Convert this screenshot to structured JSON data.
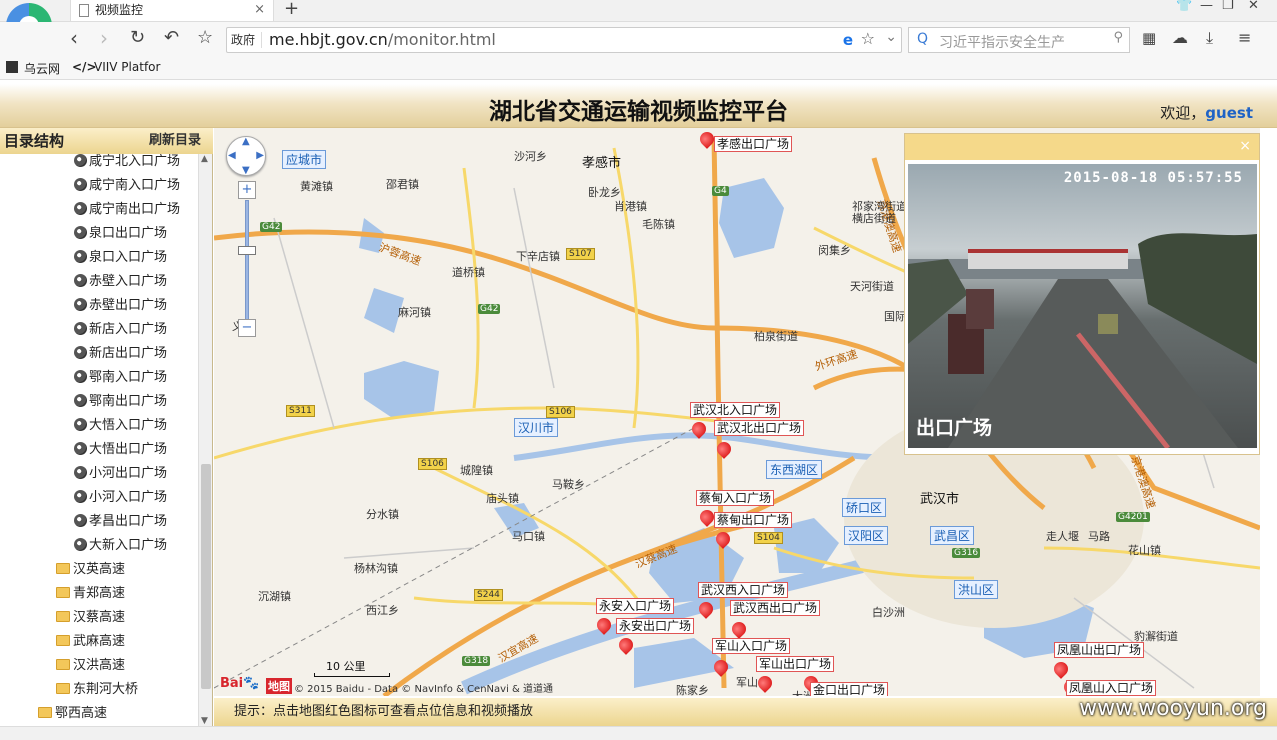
{
  "browser": {
    "tab_title": "视频监控",
    "tab_close": "×",
    "new_tab": "+",
    "gov_badge": "政府",
    "url_host": "me.hbjt.gov.cn",
    "url_path": "/monitor.html",
    "search_placeholder": "习近平指示安全生产",
    "bookmarks": [
      "乌云网",
      "VIIV Platfor"
    ],
    "bookmark_code_prefix": "</>"
  },
  "page": {
    "title": "湖北省交通运输视频监控平台",
    "welcome": "欢迎，",
    "user": "guest"
  },
  "sidebar": {
    "header": "目录结构",
    "refresh": "刷新目录",
    "cameras": [
      "咸宁北入口广场",
      "咸宁南入口广场",
      "咸宁南出口广场",
      "泉口出口广场",
      "泉口入口广场",
      "赤壁入口广场",
      "赤壁出口广场",
      "新店入口广场",
      "新店出口广场",
      "鄂南入口广场",
      "鄂南出口广场",
      "大悟入口广场",
      "大悟出口广场",
      "小河出口广场",
      "小河入口广场",
      "孝昌出口广场",
      "大新入口广场"
    ],
    "folders": [
      "汉英高速",
      "青郑高速",
      "汉蔡高速",
      "武麻高速",
      "汉洪高速",
      "东荆河大桥"
    ],
    "bottom_folder": "鄂西高速"
  },
  "map": {
    "markers": [
      {
        "label": "孝感出口广场"
      },
      {
        "label": "武汉北入口广场"
      },
      {
        "label": "武汉北出口广场"
      },
      {
        "label": "蔡甸入口广场"
      },
      {
        "label": "蔡甸出口广场"
      },
      {
        "label": "武汉西入口广场"
      },
      {
        "label": "武汉西出口广场"
      },
      {
        "label": "永安入口广场"
      },
      {
        "label": "永安出口广场"
      },
      {
        "label": "军山入口广场"
      },
      {
        "label": "军山出口广场"
      },
      {
        "label": "金口出口广场"
      },
      {
        "label": "凤凰山出口广场"
      },
      {
        "label": "凤凰山入口广场"
      }
    ],
    "districts": [
      "应城市",
      "孝感市",
      "汉川市",
      "东西湖区",
      "硚口区",
      "汉阳区",
      "武昌区",
      "洪山区",
      "武汉市"
    ],
    "places": [
      "沙河乡",
      "黄滩镇",
      "邵君镇",
      "肖港镇",
      "卧龙乡",
      "毛陈镇",
      "祁家湾街道",
      "横店街道",
      "闵集乡",
      "天河街道",
      "下辛店镇",
      "道桥镇",
      "麻河镇",
      "柏泉街道",
      "国际机",
      "马鞍乡",
      "城隍镇",
      "庙头镇",
      "分水镇",
      "马口镇",
      "杨林沟镇",
      "沉湖镇",
      "西江乡",
      "走人堰",
      "马路",
      "花山镇",
      "白沙洲",
      "豹澥街道",
      "陈家乡",
      "军山",
      "大洲",
      "义"
    ],
    "roads": [
      "沪蓉高速",
      "外环高速",
      "汉蔡高速",
      "汉宜高速",
      "京港澳高速",
      "京港澳高速"
    ],
    "shields": [
      "G42",
      "G42",
      "G4",
      "S107",
      "S106",
      "S106",
      "S311",
      "S104",
      "S244",
      "G318",
      "G316",
      "G4201"
    ],
    "scale": "10 公里",
    "copyright": "© 2015 Baidu - Data © NavInfo & CenNavi & 道道通",
    "brand": "地图"
  },
  "popup": {
    "timestamp": "2015-08-18  05:57:55",
    "label": "出口广场",
    "close": "×"
  },
  "tip": "提示：点击地图红色图标可查看点位信息和视频播放",
  "watermark": "www.wooyun.org"
}
